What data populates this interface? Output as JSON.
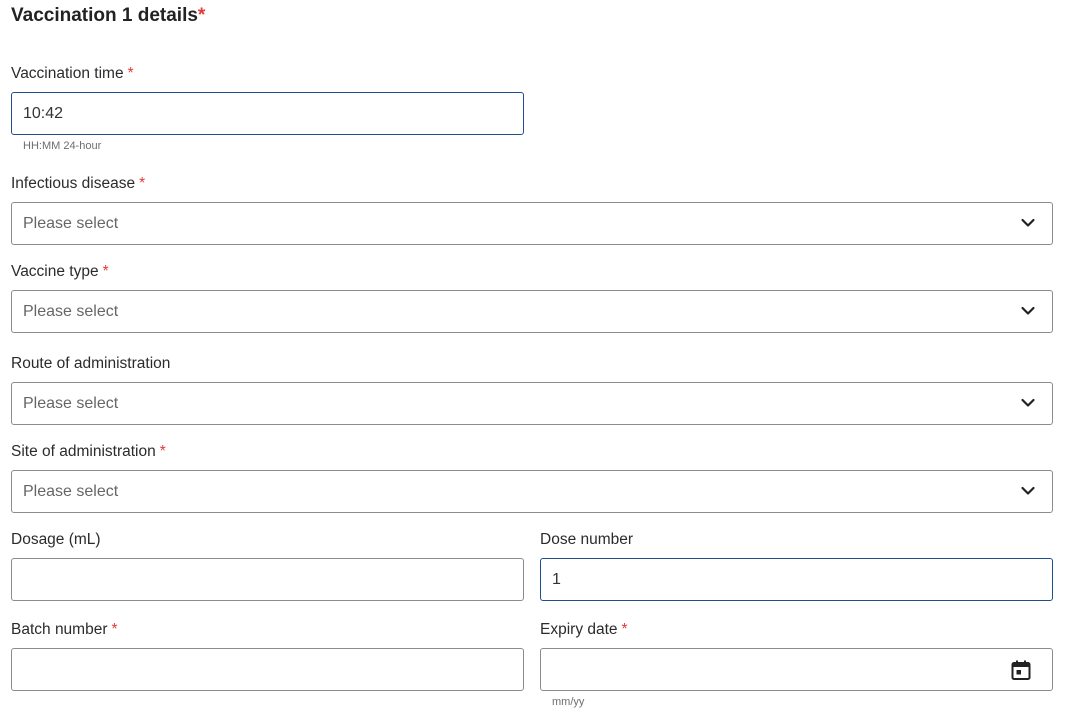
{
  "section": {
    "title": "Vaccination 1 details",
    "required_mark": "*"
  },
  "fields": {
    "vaccination_time": {
      "label": "Vaccination time",
      "required_mark": "*",
      "value": "10:42",
      "hint": "HH:MM 24-hour"
    },
    "infectious_disease": {
      "label": "Infectious disease",
      "required_mark": "*",
      "selected": "Please select"
    },
    "vaccine_type": {
      "label": "Vaccine type",
      "required_mark": "*",
      "selected": "Please select"
    },
    "route_of_administration": {
      "label": "Route of administration",
      "selected": "Please select"
    },
    "site_of_administration": {
      "label": "Site of administration",
      "required_mark": "*",
      "selected": "Please select"
    },
    "dosage": {
      "label": "Dosage (mL)",
      "value": ""
    },
    "dose_number": {
      "label": "Dose number",
      "value": "1"
    },
    "batch_number": {
      "label": "Batch number",
      "required_mark": "*",
      "value": ""
    },
    "expiry_date": {
      "label": "Expiry date",
      "required_mark": "*",
      "value": "",
      "hint": "mm/yy"
    }
  },
  "icons": {
    "dropdown": "chevron-down-icon",
    "date_picker": "calendar-icon"
  },
  "colors": {
    "required": "#e03a3a",
    "focus_border": "#1f4e8c",
    "border": "#8c8c8c"
  }
}
